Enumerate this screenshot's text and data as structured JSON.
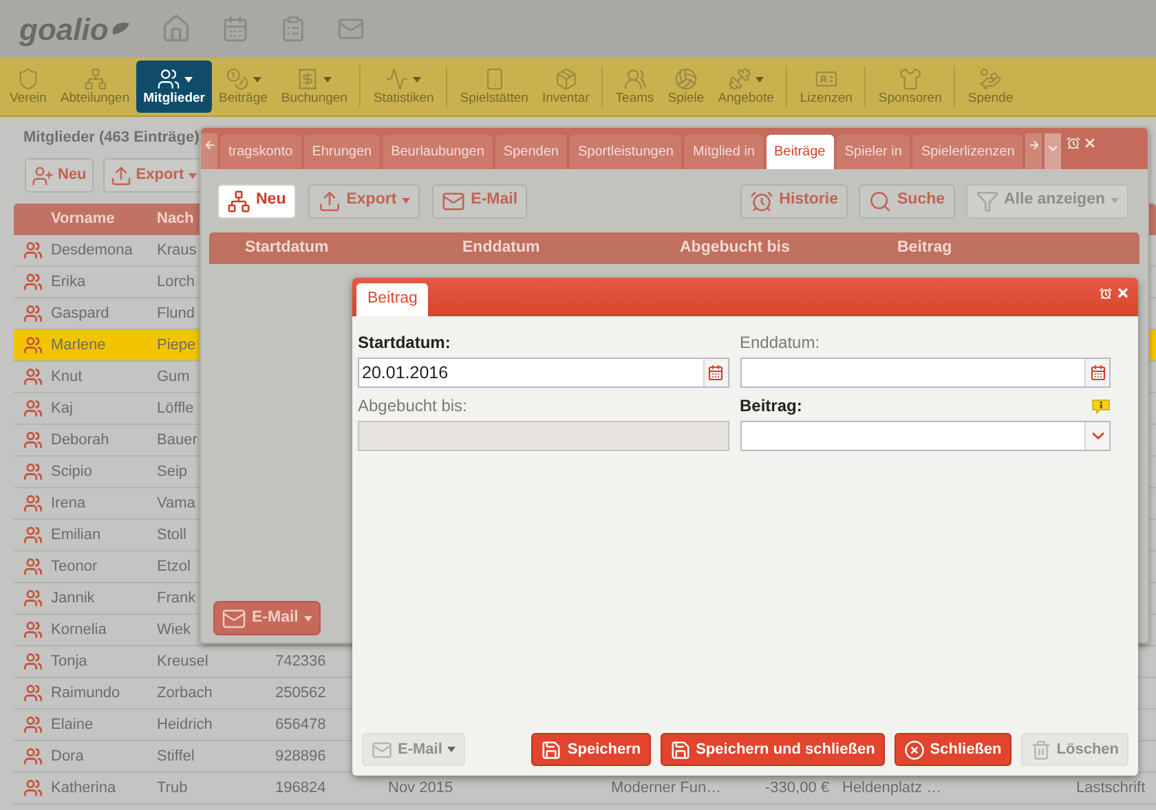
{
  "header": {
    "logo": "goalio"
  },
  "toolbar": {
    "groups": [
      {
        "items": [
          {
            "label": "Verein",
            "selected": false,
            "dropdown": false
          },
          {
            "label": "Abteilungen",
            "selected": false,
            "dropdown": false
          },
          {
            "label": "Mitglieder",
            "selected": true,
            "dropdown": true
          },
          {
            "label": "Beiträge",
            "selected": false,
            "dropdown": true
          },
          {
            "label": "Buchungen",
            "selected": false,
            "dropdown": true
          }
        ]
      },
      {
        "items": [
          {
            "label": "Statistiken",
            "selected": false,
            "dropdown": true
          }
        ]
      },
      {
        "items": [
          {
            "label": "Spielstätten",
            "selected": false,
            "dropdown": false
          },
          {
            "label": "Inventar",
            "selected": false,
            "dropdown": false
          }
        ]
      },
      {
        "items": [
          {
            "label": "Teams",
            "selected": false,
            "dropdown": false
          },
          {
            "label": "Spiele",
            "selected": false,
            "dropdown": false
          },
          {
            "label": "Angebote",
            "selected": false,
            "dropdown": true
          }
        ]
      },
      {
        "items": [
          {
            "label": "Lizenzen",
            "selected": false,
            "dropdown": false
          }
        ]
      },
      {
        "items": [
          {
            "label": "Sponsoren",
            "selected": false,
            "dropdown": false
          }
        ]
      },
      {
        "items": [
          {
            "label": "Spende",
            "selected": false,
            "dropdown": false
          }
        ]
      }
    ]
  },
  "members": {
    "title": "Mitglieder (463 Einträge)",
    "buttons": [
      {
        "label": "Neu",
        "kind": "new",
        "dropdown": false
      },
      {
        "label": "Export",
        "kind": "export",
        "dropdown": true
      }
    ],
    "table": {
      "columns": [
        "Vorname",
        "Nach"
      ],
      "rows": [
        {
          "first_name": "Desdemona",
          "last_name": "Kraus",
          "selected": false
        },
        {
          "first_name": "Erika",
          "last_name": "Lorch",
          "selected": false
        },
        {
          "first_name": "Gaspard",
          "last_name": "Flund",
          "selected": false
        },
        {
          "first_name": "Marlene",
          "last_name": "Piepe",
          "selected": true
        },
        {
          "first_name": "Knut",
          "last_name": "Gum",
          "selected": false
        },
        {
          "first_name": "Kaj",
          "last_name": "Löffle",
          "selected": false
        },
        {
          "first_name": "Deborah",
          "last_name": "Bauer",
          "selected": false
        },
        {
          "first_name": "Scipio",
          "last_name": "Seip",
          "selected": false
        },
        {
          "first_name": "Irena",
          "last_name": "Vama",
          "selected": false
        },
        {
          "first_name": "Emilian",
          "last_name": "Stoll",
          "selected": false
        },
        {
          "first_name": "Teonor",
          "last_name": "Etzol",
          "selected": false
        },
        {
          "first_name": "Jannik",
          "last_name": "Frank",
          "selected": false
        },
        {
          "first_name": "Kornelia",
          "last_name": "Wiek",
          "selected": false
        },
        {
          "first_name": "Tonja",
          "last_name": "Kreusel",
          "selected": false,
          "number": "742336"
        },
        {
          "first_name": "Raimundo",
          "last_name": "Zorbach",
          "selected": false,
          "number": "250562"
        },
        {
          "first_name": "Elaine",
          "last_name": "Heidrich",
          "selected": false,
          "number": "656478"
        },
        {
          "first_name": "Dora",
          "last_name": "Stiffel",
          "selected": false,
          "number": "928896"
        },
        {
          "first_name": "Katherina",
          "last_name": "Trub",
          "selected": false,
          "number": "196824",
          "extra": [
            "Nov 2015",
            "Moderner Fun…",
            "-330,00 €",
            "Heldenplatz …",
            "Lastschrift"
          ]
        }
      ]
    }
  },
  "tab_window": {
    "tabs": [
      {
        "label": "tragskonto",
        "selected": false
      },
      {
        "label": "Ehrungen",
        "selected": false
      },
      {
        "label": "Beurlaubungen",
        "selected": false
      },
      {
        "label": "Spenden",
        "selected": false
      },
      {
        "label": "Sportleistungen",
        "selected": false
      },
      {
        "label": "Mitglied in",
        "selected": false
      },
      {
        "label": "Beiträge",
        "selected": true
      },
      {
        "label": "Spieler in",
        "selected": false
      },
      {
        "label": "Spielerlizenzen",
        "selected": false
      }
    ],
    "left_buttons": [
      {
        "label": "Neu",
        "kind": "new",
        "active": true,
        "disabled": false,
        "dropdown": false
      },
      {
        "label": "Export",
        "kind": "export",
        "active": false,
        "disabled": false,
        "dropdown": true
      },
      {
        "label": "E-Mail",
        "kind": "email",
        "active": false,
        "disabled": false,
        "dropdown": false
      }
    ],
    "right_buttons": [
      {
        "label": "Historie",
        "kind": "history",
        "active": false,
        "disabled": false,
        "dropdown": false
      },
      {
        "label": "Suche",
        "kind": "search",
        "active": false,
        "disabled": false,
        "dropdown": false
      },
      {
        "label": "Alle anzeigen",
        "kind": "filter",
        "active": false,
        "disabled": true,
        "dropdown": true
      }
    ],
    "table": {
      "columns": [
        "Startdatum",
        "Enddatum",
        "Abgebucht bis",
        "Beitrag"
      ]
    },
    "footer_button": {
      "label": "E-Mail",
      "dropdown": true
    }
  },
  "dialog": {
    "tab": "Beitrag",
    "fields": [
      {
        "label": "Startdatum:",
        "required": true,
        "kind": "date",
        "value": "20.01.2016",
        "info": false
      },
      {
        "label": "Enddatum:",
        "required": false,
        "kind": "date",
        "info": false
      },
      {
        "label": "Abgebucht bis:",
        "required": false,
        "kind": "readonly",
        "info": false
      },
      {
        "label": "Beitrag:",
        "required": true,
        "kind": "select",
        "info": true
      }
    ],
    "buttons": [
      {
        "label": "E-Mail",
        "kind": "email",
        "disabled": true,
        "dropdown": true
      },
      {
        "label": "Speichern",
        "kind": "save",
        "disabled": false,
        "dropdown": false
      },
      {
        "label": "Speichern und schließen",
        "kind": "save_close",
        "disabled": false,
        "dropdown": false
      },
      {
        "label": "Schließen",
        "kind": "close",
        "disabled": false,
        "dropdown": false
      },
      {
        "label": "Löschen",
        "kind": "delete",
        "disabled": true,
        "dropdown": false
      }
    ]
  }
}
